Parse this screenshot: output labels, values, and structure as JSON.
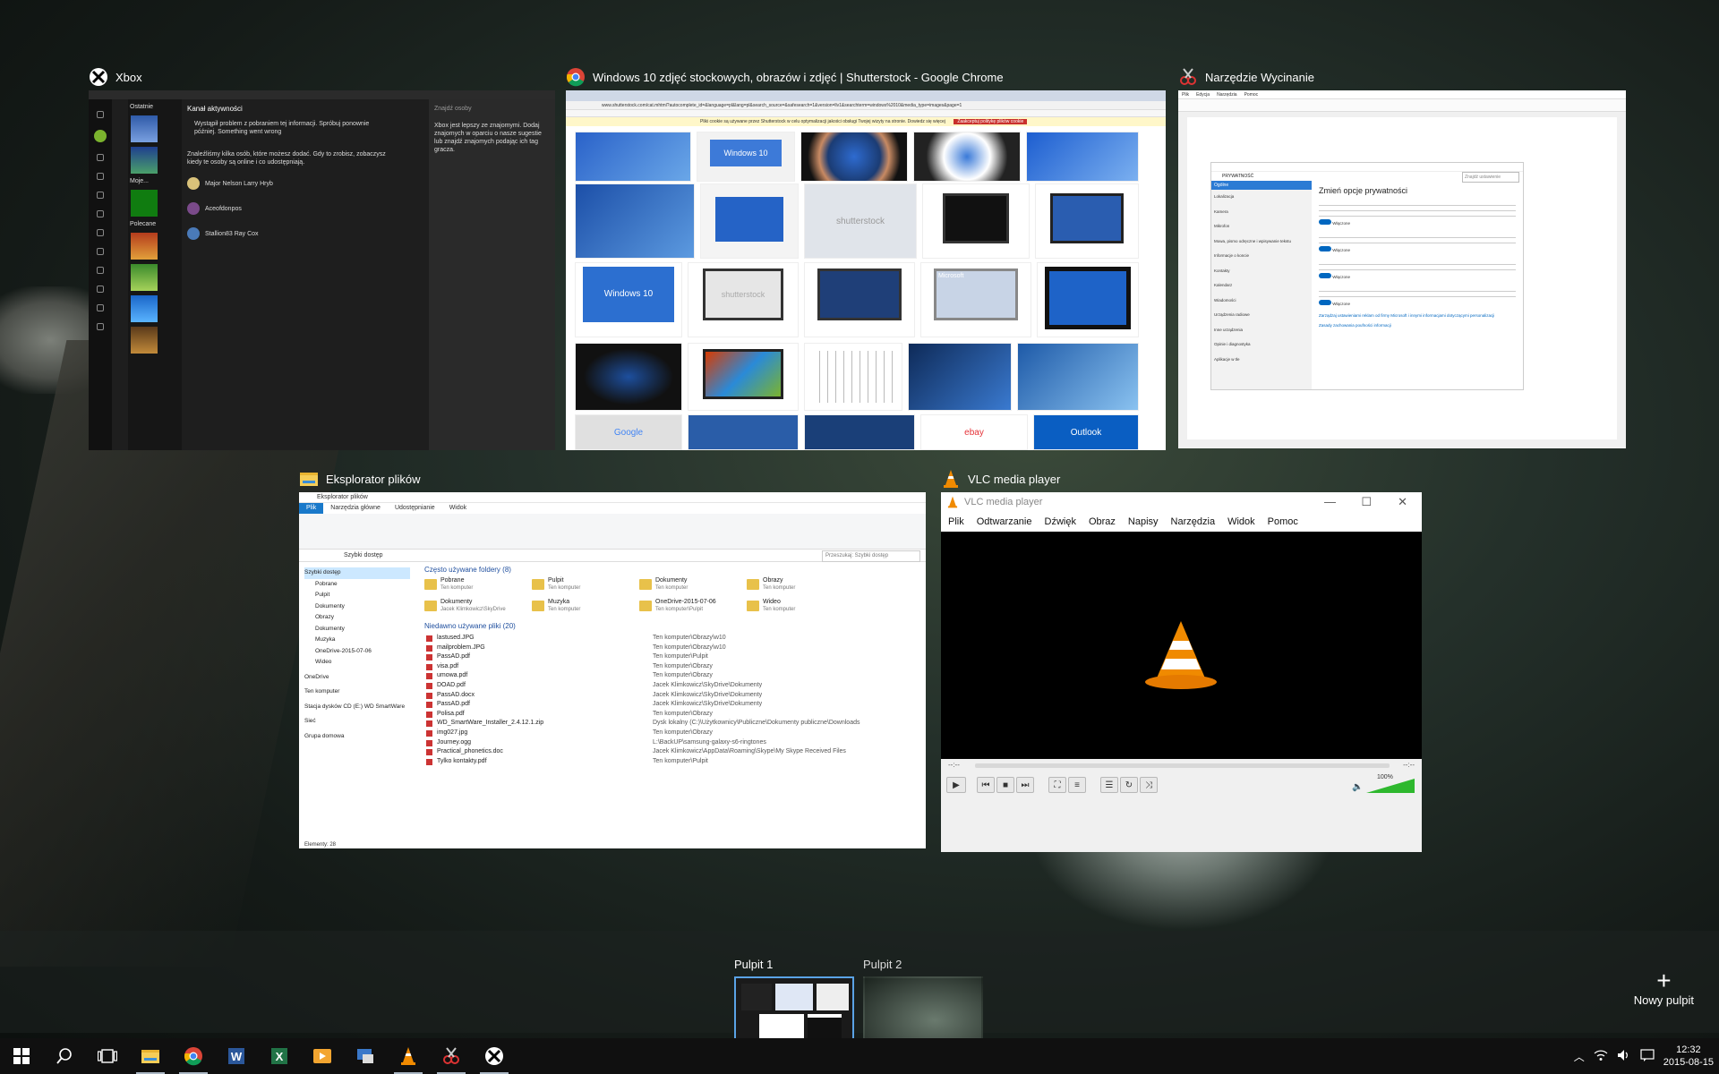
{
  "windows": {
    "xbox": {
      "title": "Xbox",
      "header_recent": "Ostatnie",
      "header_feed": "Kanał aktywności",
      "error": "Wystąpił problem z pobraniem tej informacji. Spróbuj ponownie później. Something went wrong",
      "suggest": "Znaleźliśmy kilka osób, które możesz dodać. Gdy to zrobisz, zobaczysz kiedy te osoby są online i co udostępniają.",
      "people": [
        "Major Nelson Larry Hryb",
        "Aceofdonpos",
        "Stallion83 Ray Cox"
      ],
      "search_placeholder": "Znajdź osoby",
      "friends_text": "Xbox jest lepszy ze znajomymi. Dodaj znajomych w oparciu o nasze sugestie lub znajdź znajomych podając ich tag gracza.",
      "moje_label": "Moje...",
      "polecane_label": "Polecane"
    },
    "chrome": {
      "title": "Windows 10 zdjęć stockowych, obrazów i zdjęć | Shutterstock - Google Chrome",
      "address": "www.shutterstock.com/cat.mhtml?autocomplete_id=&language=pl&lang=pl&search_source=&safesearch=1&version=llv1&searchterm=windows%2010&media_type=images&page=1",
      "warning": "Pliki cookie są używane przez Shutterstock w celu optymalizacji jakości obsługi Twojej wizyty na stronie. Dowiedz się więcej",
      "warning_button": "Zaakceptuj politykę plików cookie",
      "thumbs": [
        "Windows 10",
        "Windows 10",
        "shutterstock",
        "shutterstock",
        "Windows 10",
        "Microsoft",
        "Outlook",
        "Google",
        "ebay"
      ]
    },
    "snip": {
      "title": "Narzędzie Wycinanie",
      "menu": [
        "Plik",
        "Edycja",
        "Narzędzia",
        "Pomoc"
      ],
      "settings_header": "PRYWATNOŚĆ",
      "settings_search": "Znajdź ustawienie",
      "settings_title": "Zmień opcje prywatności",
      "side_items": [
        "Ogólne",
        "Lokalizacja",
        "Kamera",
        "Mikrofon",
        "Mowa, pismo odręczne i wpisywanie tekstu",
        "Informacje o koncie",
        "Kontakty",
        "Kalendarz",
        "Wiadomości",
        "Urządzenia radiowe",
        "Inne urządzenia",
        "Opinie i diagnostyka",
        "Aplikacje w tle"
      ],
      "on_label": "Włączone",
      "link1": "Zarządzaj ustawieniami reklam od firmy Microsoft i innymi informacjami dotyczącymi personalizacji",
      "link2": "Zasady zachowania poufności informacji"
    },
    "explorer": {
      "title": "Eksplorator plików",
      "window_title": "Eksplorator plików",
      "ribbon_tabs": [
        "Plik",
        "Narzędzia główne",
        "Udostępnianie",
        "Widok"
      ],
      "address": "Szybki dostęp",
      "search_placeholder": "Przeszukaj: Szybki dostęp",
      "nav": [
        "Szybki dostęp",
        "Pobrane",
        "Pulpit",
        "Dokumenty",
        "Obrazy",
        "Dokumenty",
        "Muzyka",
        "OneDrive-2015-07-06",
        "Wideo",
        "OneDrive",
        "Ten komputer",
        "Stacja dysków CD (E:) WD SmartWare",
        "Sieć",
        "Grupa domowa"
      ],
      "frequent_header": "Często używane foldery (8)",
      "folders": [
        {
          "name": "Pobrane",
          "loc": "Ten komputer"
        },
        {
          "name": "Pulpit",
          "loc": "Ten komputer"
        },
        {
          "name": "Dokumenty",
          "loc": "Ten komputer"
        },
        {
          "name": "Obrazy",
          "loc": "Ten komputer"
        },
        {
          "name": "Dokumenty",
          "loc": "Jacek Klimkowicz\\SkyDrive"
        },
        {
          "name": "Muzyka",
          "loc": "Ten komputer"
        },
        {
          "name": "OneDrive-2015-07-06",
          "loc": "Ten komputer\\Pulpit"
        },
        {
          "name": "Wideo",
          "loc": "Ten komputer"
        }
      ],
      "recent_header": "Niedawno używane pliki (20)",
      "recent": [
        {
          "name": "lastused.JPG",
          "path": "Ten komputer\\Obrazy\\w10"
        },
        {
          "name": "mailproblem.JPG",
          "path": "Ten komputer\\Obrazy\\w10"
        },
        {
          "name": "PassAD.pdf",
          "path": "Ten komputer\\Pulpit"
        },
        {
          "name": "visa.pdf",
          "path": "Ten komputer\\Obrazy"
        },
        {
          "name": "umowa.pdf",
          "path": "Ten komputer\\Obrazy"
        },
        {
          "name": "DOAD.pdf",
          "path": "Jacek Klimkowicz\\SkyDrive\\Dokumenty"
        },
        {
          "name": "PassAD.docx",
          "path": "Jacek Klimkowicz\\SkyDrive\\Dokumenty"
        },
        {
          "name": "PassAD.pdf",
          "path": "Jacek Klimkowicz\\SkyDrive\\Dokumenty"
        },
        {
          "name": "Polisa.pdf",
          "path": "Ten komputer\\Obrazy"
        },
        {
          "name": "WD_SmartWare_Installer_2.4.12.1.zip",
          "path": "Dysk lokalny (C:)\\Użytkownicy\\Publiczne\\Dokumenty publiczne\\Downloads"
        },
        {
          "name": "img027.jpg",
          "path": "Ten komputer\\Obrazy"
        },
        {
          "name": "Journey.ogg",
          "path": "L:\\BackUP\\samsung-galaxy-s6-ringtones"
        },
        {
          "name": "Practical_phonetics.doc",
          "path": "Jacek Klimkowicz\\AppData\\Roaming\\Skype\\My Skype Received Files"
        },
        {
          "name": "Tylko kontakty.pdf",
          "path": "Ten komputer\\Pulpit"
        }
      ],
      "status": "Elementy: 28"
    },
    "vlc": {
      "title": "VLC media player",
      "window_title": "VLC media player",
      "menu": [
        "Plik",
        "Odtwarzanie",
        "Dźwięk",
        "Obraz",
        "Napisy",
        "Narzędzia",
        "Widok",
        "Pomoc"
      ],
      "time_left": "--:--",
      "time_right": "--:--",
      "volume": "100%"
    }
  },
  "desktops": {
    "items": [
      "Pulpit 1",
      "Pulpit 2"
    ],
    "new_label": "Nowy pulpit"
  },
  "taskbar": {
    "apps": [
      "start-icon",
      "search-icon",
      "task-view-icon",
      "file-explorer-icon",
      "chrome-icon",
      "word-icon",
      "excel-icon",
      "media-icon",
      "snipping-tool-icon",
      "vlc-icon",
      "paint-icon",
      "xbox-icon"
    ],
    "time": "12:32",
    "date": "2015-08-15"
  },
  "colors": {
    "accent": "#5aa3e6",
    "vlc_orange": "#f08a00",
    "xbox_green": "#107c10"
  }
}
